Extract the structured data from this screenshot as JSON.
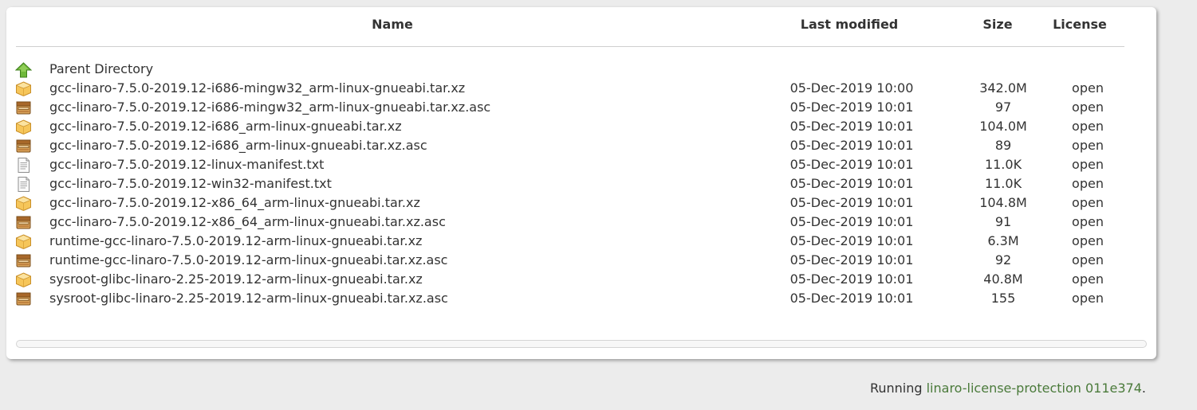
{
  "table": {
    "headers": {
      "name": "Name",
      "last_modified": "Last modified",
      "size": "Size",
      "license": "License"
    },
    "parent": {
      "label": "Parent Directory",
      "icon": "up-arrow-icon"
    },
    "rows": [
      {
        "name": "gcc-linaro-7.5.0-2019.12-i686-mingw32_arm-linux-gnueabi.tar.xz",
        "modified": "05-Dec-2019 10:00",
        "size": "342.0M",
        "license": "open",
        "icon": "archive-icon"
      },
      {
        "name": "gcc-linaro-7.5.0-2019.12-i686-mingw32_arm-linux-gnueabi.tar.xz.asc",
        "modified": "05-Dec-2019 10:01",
        "size": "97",
        "license": "open",
        "icon": "box-icon"
      },
      {
        "name": "gcc-linaro-7.5.0-2019.12-i686_arm-linux-gnueabi.tar.xz",
        "modified": "05-Dec-2019 10:01",
        "size": "104.0M",
        "license": "open",
        "icon": "archive-icon"
      },
      {
        "name": "gcc-linaro-7.5.0-2019.12-i686_arm-linux-gnueabi.tar.xz.asc",
        "modified": "05-Dec-2019 10:01",
        "size": "89",
        "license": "open",
        "icon": "box-icon"
      },
      {
        "name": "gcc-linaro-7.5.0-2019.12-linux-manifest.txt",
        "modified": "05-Dec-2019 10:01",
        "size": "11.0K",
        "license": "open",
        "icon": "text-file-icon"
      },
      {
        "name": "gcc-linaro-7.5.0-2019.12-win32-manifest.txt",
        "modified": "05-Dec-2019 10:01",
        "size": "11.0K",
        "license": "open",
        "icon": "text-file-icon"
      },
      {
        "name": "gcc-linaro-7.5.0-2019.12-x86_64_arm-linux-gnueabi.tar.xz",
        "modified": "05-Dec-2019 10:01",
        "size": "104.8M",
        "license": "open",
        "icon": "archive-icon"
      },
      {
        "name": "gcc-linaro-7.5.0-2019.12-x86_64_arm-linux-gnueabi.tar.xz.asc",
        "modified": "05-Dec-2019 10:01",
        "size": "91",
        "license": "open",
        "icon": "box-icon"
      },
      {
        "name": "runtime-gcc-linaro-7.5.0-2019.12-arm-linux-gnueabi.tar.xz",
        "modified": "05-Dec-2019 10:01",
        "size": "6.3M",
        "license": "open",
        "icon": "archive-icon"
      },
      {
        "name": "runtime-gcc-linaro-7.5.0-2019.12-arm-linux-gnueabi.tar.xz.asc",
        "modified": "05-Dec-2019 10:01",
        "size": "92",
        "license": "open",
        "icon": "box-icon"
      },
      {
        "name": "sysroot-glibc-linaro-2.25-2019.12-arm-linux-gnueabi.tar.xz",
        "modified": "05-Dec-2019 10:01",
        "size": "40.8M",
        "license": "open",
        "icon": "archive-icon"
      },
      {
        "name": "sysroot-glibc-linaro-2.25-2019.12-arm-linux-gnueabi.tar.xz.asc",
        "modified": "05-Dec-2019 10:01",
        "size": "155",
        "license": "open",
        "icon": "box-icon"
      }
    ]
  },
  "footer": {
    "prefix": "Running ",
    "link": "linaro-license-protection 011e374",
    "suffix": "."
  },
  "colors": {
    "page_bg": "#ececec",
    "card_bg": "#ffffff",
    "footer_link": "#4a7a3a",
    "archive_yellow": "#f6c65a",
    "box_brown": "#b07a34"
  }
}
